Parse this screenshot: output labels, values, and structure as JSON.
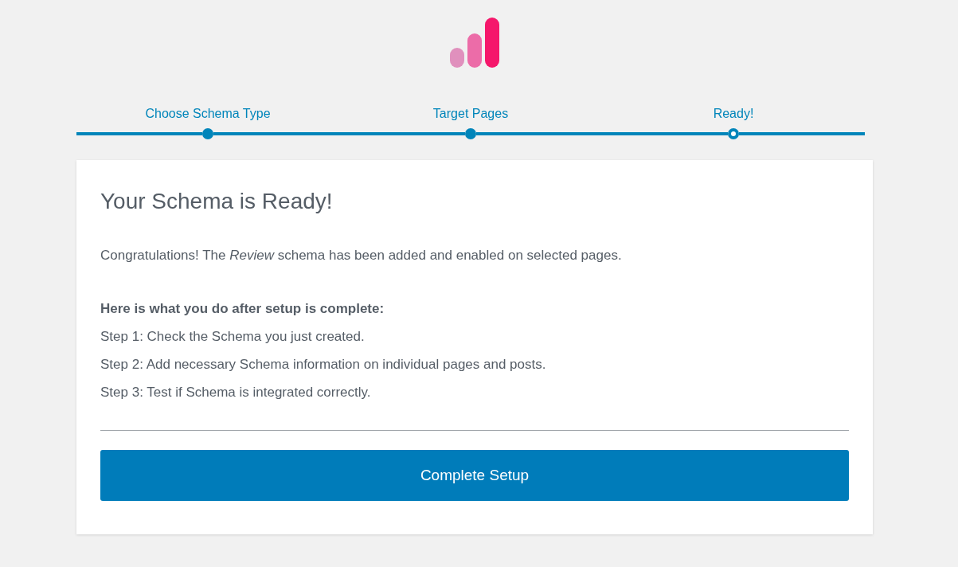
{
  "steps": [
    {
      "label": "Choose Schema Type",
      "selected": false
    },
    {
      "label": "Target Pages",
      "selected": false
    },
    {
      "label": "Ready!",
      "selected": true
    }
  ],
  "card": {
    "title": "Your Schema is Ready!",
    "message": "Congratulations! The *Review* schema has been added and enabled on selected pages.",
    "instructions": {
      "heading": "Here is what you do after setup is complete:",
      "items": [
        "Step 1: Check the Schema you just created.",
        "Step 2: Add necessary Schema information on individual pages and posts.",
        "Step 3: Test if Schema is integrated correctly."
      ]
    },
    "button": "Complete Setup"
  }
}
